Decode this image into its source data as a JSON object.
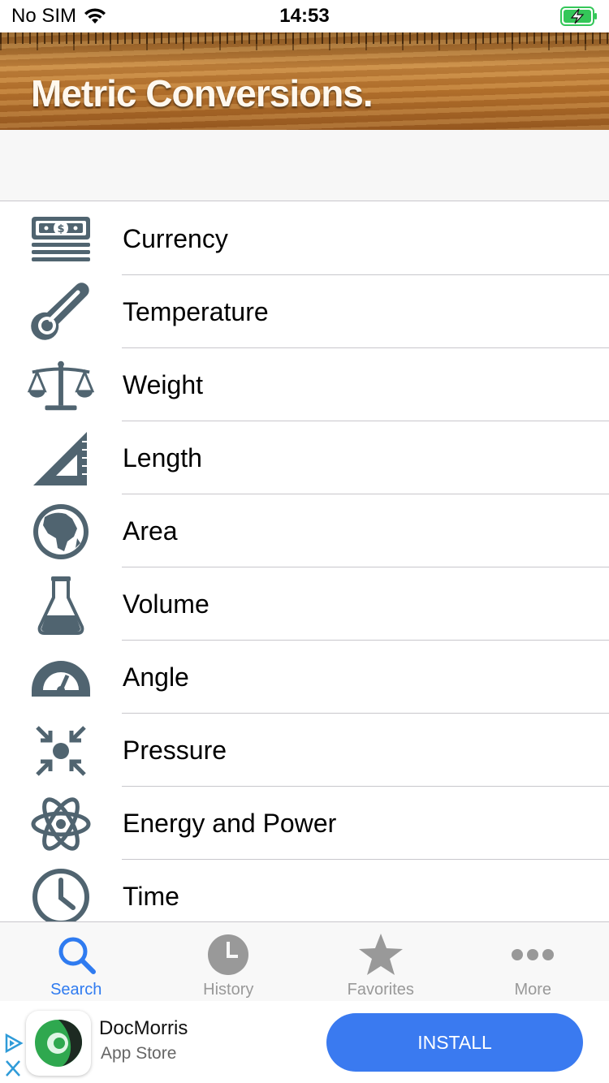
{
  "status_bar": {
    "carrier": "No SIM",
    "time": "14:53"
  },
  "header": {
    "title": "Metric Conversions."
  },
  "categories": [
    {
      "label": "Currency",
      "icon": "money-stack-icon"
    },
    {
      "label": "Temperature",
      "icon": "thermometer-icon"
    },
    {
      "label": "Weight",
      "icon": "scale-icon"
    },
    {
      "label": "Length",
      "icon": "set-square-icon"
    },
    {
      "label": "Area",
      "icon": "globe-icon"
    },
    {
      "label": "Volume",
      "icon": "flask-icon"
    },
    {
      "label": "Angle",
      "icon": "protractor-icon"
    },
    {
      "label": "Pressure",
      "icon": "compress-arrows-icon"
    },
    {
      "label": "Energy and Power",
      "icon": "atom-icon"
    },
    {
      "label": "Time",
      "icon": "clock-icon"
    }
  ],
  "tabs": [
    {
      "label": "Search",
      "icon": "search-icon",
      "active": true
    },
    {
      "label": "History",
      "icon": "history-clock-icon",
      "active": false
    },
    {
      "label": "Favorites",
      "icon": "star-icon",
      "active": false
    },
    {
      "label": "More",
      "icon": "more-dots-icon",
      "active": false
    }
  ],
  "ad": {
    "app_name": "DocMorris",
    "store": "App Store",
    "install_label": "INSTALL"
  },
  "colors": {
    "icon_gray": "#506470",
    "tab_active": "#2f7bf0",
    "tab_inactive": "#999999",
    "install_button": "#3a7af0"
  }
}
